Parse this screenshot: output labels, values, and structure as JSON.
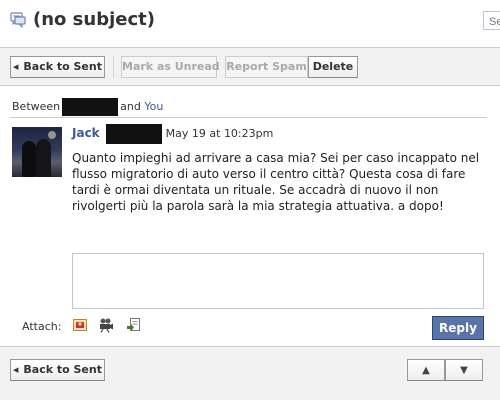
{
  "header": {
    "subject": "(no subject)",
    "search_placeholder": "Se"
  },
  "toolbar": {
    "back_label": "Back to Sent",
    "mark_unread_label": "Mark as Unread",
    "report_spam_label": "Report Spam",
    "delete_label": "Delete"
  },
  "participants": {
    "between_label": "Between",
    "and_label": "and",
    "you_label": "You"
  },
  "message": {
    "sender": "Jack",
    "timestamp": "May 19 at 10:23pm",
    "body": "Quanto impieghi ad arrivare a casa mia? Sei per caso incappato nel flusso migratorio di auto verso il centro città? Questa cosa di fare tardi è ormai diventata un rituale. Se accadrà di nuovo il non rivolgerti più la parola sarà la mia strategia attuativa. a dopo!"
  },
  "reply": {
    "attach_label": "Attach:",
    "reply_label": "Reply"
  },
  "bottom_toolbar": {
    "back_label": "Back to Sent",
    "up_label": "▲",
    "down_label": "▼"
  },
  "colors": {
    "link": "#3b5998",
    "reply_button": "#5b74a8",
    "toolbar_bg": "#f2f2f2"
  },
  "icons": {
    "message": "message-icon",
    "attach_photo": "photo-icon",
    "attach_video": "video-icon",
    "attach_link": "link-icon"
  }
}
